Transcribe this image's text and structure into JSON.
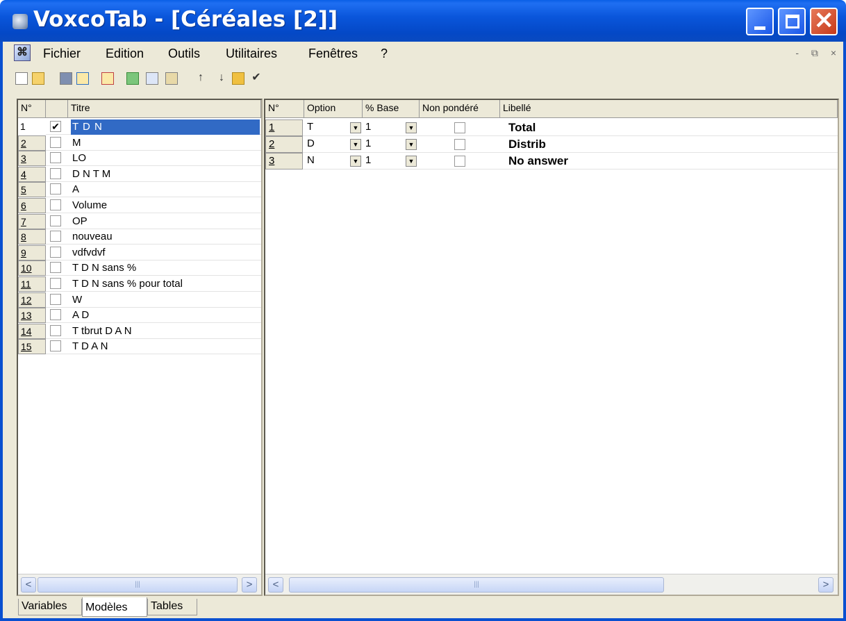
{
  "window": {
    "title": "VoxcoTab - [Céréales [2]]",
    "close_glyph": "✕"
  },
  "menu": {
    "items": [
      "Fichier",
      "Edition",
      "Outils",
      "Utilitaires",
      "Fenêtres",
      "?"
    ],
    "mdi_controls": [
      "-",
      "⧉",
      "×"
    ]
  },
  "toolbar": {
    "icons": [
      "new-icon",
      "open-icon",
      "save-icon",
      "insert-column-icon",
      "delete-column-icon",
      "add-icon",
      "copy-icon",
      "paste-icon",
      "move-up-icon",
      "move-down-icon",
      "run-icon",
      "validate-icon"
    ],
    "glyphs": {
      "move_up": "↑",
      "move_down": "↓",
      "validate": "✔"
    }
  },
  "left_grid": {
    "headers": {
      "num": "N°",
      "titre": "Titre"
    },
    "rows": [
      {
        "num": "1",
        "checked": true,
        "titre": "T D N",
        "selected": true
      },
      {
        "num": "2",
        "checked": false,
        "titre": "M"
      },
      {
        "num": "3",
        "checked": false,
        "titre": "LO"
      },
      {
        "num": "4",
        "checked": false,
        "titre": "D N T M"
      },
      {
        "num": "5",
        "checked": false,
        "titre": "A"
      },
      {
        "num": "6",
        "checked": false,
        "titre": "Volume"
      },
      {
        "num": "7",
        "checked": false,
        "titre": "OP"
      },
      {
        "num": "8",
        "checked": false,
        "titre": "nouveau"
      },
      {
        "num": "9",
        "checked": false,
        "titre": "vdfvdvf"
      },
      {
        "num": "10",
        "checked": false,
        "titre": "T D N sans %"
      },
      {
        "num": "11",
        "checked": false,
        "titre": "T D N sans % pour total"
      },
      {
        "num": "12",
        "checked": false,
        "titre": "W"
      },
      {
        "num": "13",
        "checked": false,
        "titre": "A D"
      },
      {
        "num": "14",
        "checked": false,
        "titre": "T  tbrut  D A N"
      },
      {
        "num": "15",
        "checked": false,
        "titre": "T D A N"
      }
    ],
    "check_glyph": "✔"
  },
  "right_grid": {
    "headers": {
      "num": "N°",
      "option": "Option",
      "base": "% Base",
      "non_pondere": "Non pondéré",
      "libelle": "Libellé"
    },
    "rows": [
      {
        "num": "1",
        "option": "T",
        "base": "1",
        "non_pondere": false,
        "libelle": "Total"
      },
      {
        "num": "2",
        "option": "D",
        "base": "1",
        "non_pondere": false,
        "libelle": "Distrib"
      },
      {
        "num": "3",
        "option": "N",
        "base": "1",
        "non_pondere": false,
        "libelle": "No answer"
      }
    ]
  },
  "scroll": {
    "left_arrow": "<",
    "right_arrow": ">",
    "grip": "|||"
  },
  "tabs": [
    "Variables",
    "Modèles",
    "Tables"
  ],
  "active_tab": "Modèles"
}
